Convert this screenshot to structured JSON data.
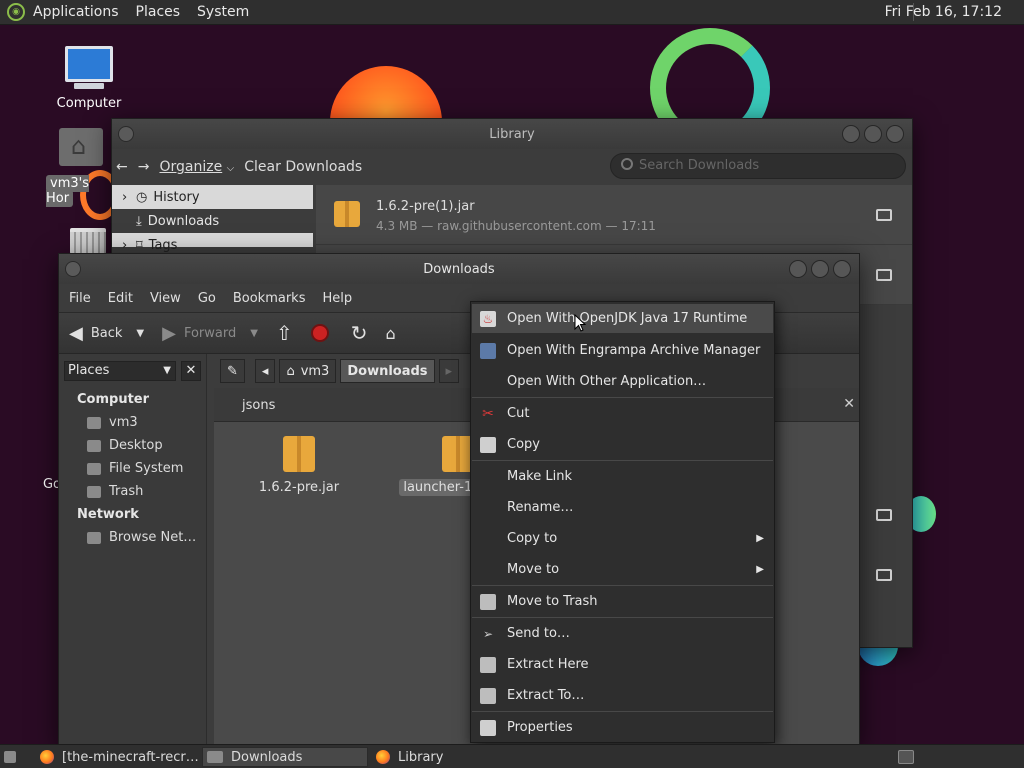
{
  "top_panel": {
    "menus": [
      "Applications",
      "Places",
      "System"
    ],
    "clock": "Fri Feb 16, 17:12"
  },
  "desktop": {
    "icons": {
      "computer": "Computer",
      "home": "vm3's Hor",
      "go": "Go"
    }
  },
  "library": {
    "title": "Library",
    "toolbar": {
      "back_glyph": "←",
      "forward_glyph": "→",
      "organize": "Organize",
      "organize_caret": "⌵",
      "clear": "Clear Downloads"
    },
    "search_placeholder": "Search Downloads",
    "sidebar": [
      {
        "label": "History",
        "glyph": "›"
      },
      {
        "label": "Downloads",
        "glyph": ""
      },
      {
        "label": "Tags",
        "glyph": "›"
      }
    ],
    "downloads": [
      {
        "name": "1.6.2-pre(1).jar",
        "meta": "4.3 MB — raw.githubusercontent.com — 17:11"
      }
    ]
  },
  "downloads_window": {
    "title": "Downloads",
    "menubar": [
      "File",
      "Edit",
      "View",
      "Go",
      "Bookmarks",
      "Help"
    ],
    "nav": {
      "back": "Back",
      "forward": "Forward"
    },
    "places": {
      "select": "Places",
      "close": "✕",
      "computer_heading": "Computer",
      "computer_items": [
        "vm3",
        "Desktop",
        "File System",
        "Trash"
      ],
      "network_heading": "Network",
      "network_items": [
        "Browse Net…"
      ]
    },
    "path": {
      "crumbs": [
        "vm3",
        "Downloads"
      ]
    },
    "tab": {
      "label": "jsons",
      "close": "✕"
    },
    "files": [
      {
        "name": "1.6.2-pre.jar"
      },
      {
        "name": "launcher-1.0"
      }
    ]
  },
  "context_menu": {
    "items": [
      {
        "label": "Open With OpenJDK Java 17 Runtime",
        "icon": "java-icon"
      },
      {
        "label": "Open With Engrampa Archive Manager",
        "icon": "archive-icon"
      },
      {
        "label": "Open With Other Application…",
        "icon": ""
      },
      {
        "label": "Cut",
        "icon": "scissors-icon"
      },
      {
        "label": "Copy",
        "icon": "copy-icon"
      },
      {
        "label": "Make Link",
        "icon": ""
      },
      {
        "label": "Rename…",
        "icon": ""
      },
      {
        "label": "Copy to",
        "icon": ""
      },
      {
        "label": "Move to",
        "icon": ""
      },
      {
        "label": "Move to Trash",
        "icon": "trash-icon"
      },
      {
        "label": "Send to…",
        "icon": "send-icon"
      },
      {
        "label": "Extract Here",
        "icon": "extract-icon"
      },
      {
        "label": "Extract To…",
        "icon": "extract-to-icon"
      },
      {
        "label": "Properties",
        "icon": "properties-icon"
      }
    ],
    "submenu_arrow": "▶"
  },
  "taskbar": {
    "tasks": [
      {
        "label": "[the-minecraft-recr…"
      },
      {
        "label": "Downloads"
      },
      {
        "label": "Library"
      }
    ]
  },
  "colors": {
    "desktop_bg": "#2a0b24",
    "panel": "#2f2f2f",
    "window": "#3c3c3c",
    "menu_hover": "#4a4a4a",
    "stop_red": "#cc2222"
  }
}
